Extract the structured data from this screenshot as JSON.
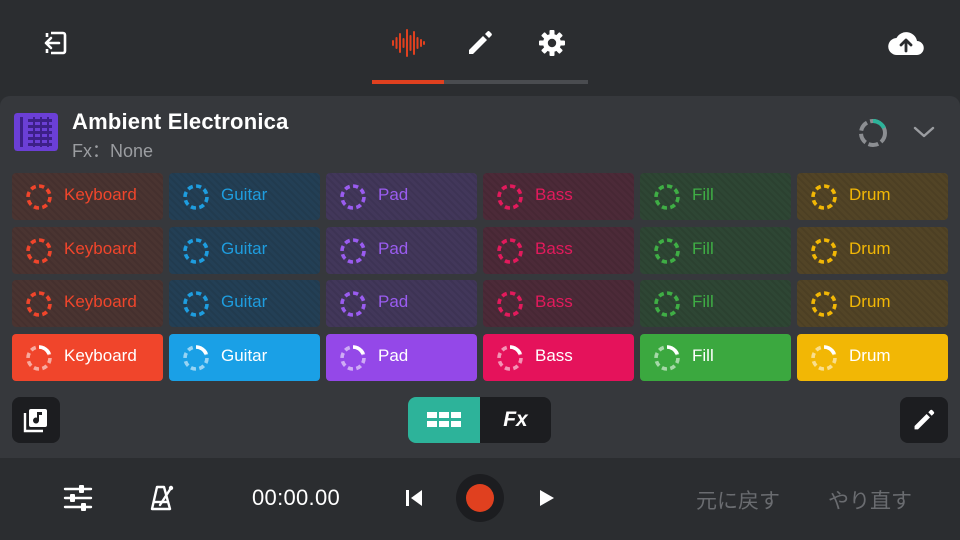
{
  "tabs": [
    {
      "name": "waveform",
      "active": true
    },
    {
      "name": "edit",
      "active": false
    },
    {
      "name": "settings",
      "active": false
    }
  ],
  "song": {
    "title": "Ambient Electronica",
    "fx": "Fx：None"
  },
  "colors": {
    "accent": "#e0401f",
    "teal": "#2db39a",
    "keyboard": "#f0452b",
    "guitar": "#1aa0e6",
    "pad": "#9448e8",
    "bass": "#e5125b",
    "fill": "#3ba83f",
    "drum": "#f2b705"
  },
  "pads": {
    "columns": [
      {
        "key": "keyboard",
        "label": "Keyboard",
        "color": "#f0452b",
        "dim_bg": "#4a3431",
        "dim_text": "#f0452b"
      },
      {
        "key": "guitar",
        "label": "Guitar",
        "color": "#1aa0e6",
        "dim_bg": "#233f55",
        "dim_text": "#1e9ddf"
      },
      {
        "key": "pad",
        "label": "Pad",
        "color": "#9448e8",
        "dim_bg": "#42375a",
        "dim_text": "#9a5cf0"
      },
      {
        "key": "bass",
        "label": "Bass",
        "color": "#e5125b",
        "dim_bg": "#4c2a38",
        "dim_text": "#e21a5c"
      },
      {
        "key": "fill",
        "label": "Fill",
        "color": "#3ba83f",
        "dim_bg": "#2e4634",
        "dim_text": "#3fae45"
      },
      {
        "key": "drum",
        "label": "Drum",
        "color": "#f2b705",
        "dim_bg": "#524426",
        "dim_text": "#f2b705"
      }
    ],
    "rows": 4,
    "active_row": 4
  },
  "mode_toggle": {
    "grid_icon": "grid-icon",
    "fx_label": "Fx"
  },
  "transport": {
    "time": "00:00.00",
    "undo_label": "元に戻す",
    "redo_label": "やり直す"
  },
  "icons": {
    "exit": "exit-icon",
    "waveform": "waveform-icon",
    "edit": "pencil-icon",
    "settings": "gear-icon",
    "upload": "cloud-upload-icon",
    "sync": "sync-icon",
    "collapse": "chevron-down-icon",
    "library": "music-library-icon",
    "mixer": "sliders-icon",
    "metronome": "metronome-icon",
    "prev": "skip-previous-icon",
    "record": "record-icon",
    "play": "play-icon"
  }
}
